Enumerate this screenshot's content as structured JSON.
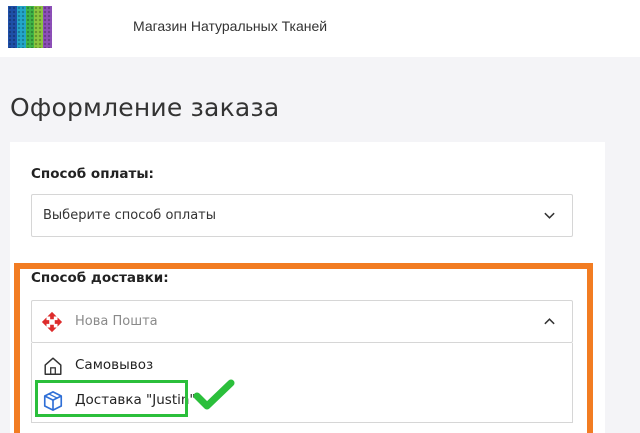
{
  "header": {
    "logo_colors": [
      "#1f4fa8",
      "#23a6c9",
      "#3fb548",
      "#8cc63f",
      "#8d4fb8"
    ],
    "store_name": "Магазин Натуральных Тканей"
  },
  "page": {
    "title": "Оформление заказа"
  },
  "payment": {
    "label": "Способ оплаты:",
    "selected": "Выберите способ оплаты"
  },
  "delivery": {
    "label": "Способ доставки:",
    "selected": "Нова Пошта",
    "selected_icon": "nova-poshta-icon",
    "options": [
      {
        "label": "Самовывоз",
        "icon": "home-icon"
      },
      {
        "label": "Доставка \"Justin\"",
        "icon": "justin-box-icon"
      }
    ]
  },
  "annotations": {
    "highlight_color": "#f27c22",
    "option_highlight_color": "#2bbf3b",
    "check_icon": "checkmark-icon"
  }
}
